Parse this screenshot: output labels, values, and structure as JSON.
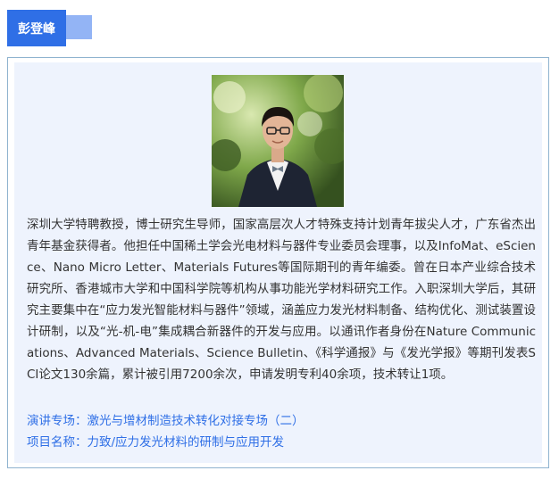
{
  "speaker": {
    "name": "彭登峰"
  },
  "bio": "深圳大学特聘教授，博士研究生导师，国家高层次人才特殊支持计划青年拔尖人才，广东省杰出青年基金获得者。他担任中国稀土学会光电材料与器件专业委员会理事，以及InfoMat、eScience、Nano Micro Letter、Materials Futures等国际期刊的青年编委。曾在日本产业综合技术研究所、香港城市大学和中国科学院等机构从事功能光学材料研究工作。入职深圳大学后，其研究主要集中在“应力发光智能材料与器件”领域，涵盖应力发光材料制备、结构优化、测试装置设计研制，以及“光-机-电”集成耦合新器件的开发与应用。以通讯作者身份在Nature Communications、Advanced Materials、Science Bulletin、《科学通报》与《发光学报》等期刊发表SCI论文130余篇，累计被引用7200余次，申请发明专利40余项，技术转让1项。",
  "session": {
    "label": "演讲专场：",
    "value": "激光与增材制造技术转化对接专场（二）"
  },
  "project": {
    "label": "项目名称：",
    "value": "力致/应力发光材料的研制与应用开发"
  },
  "colors": {
    "accent": "#2f6fe6",
    "accent_light": "#93b4f5",
    "panel_bg": "#eef3fd",
    "border": "#8fb3cf"
  }
}
